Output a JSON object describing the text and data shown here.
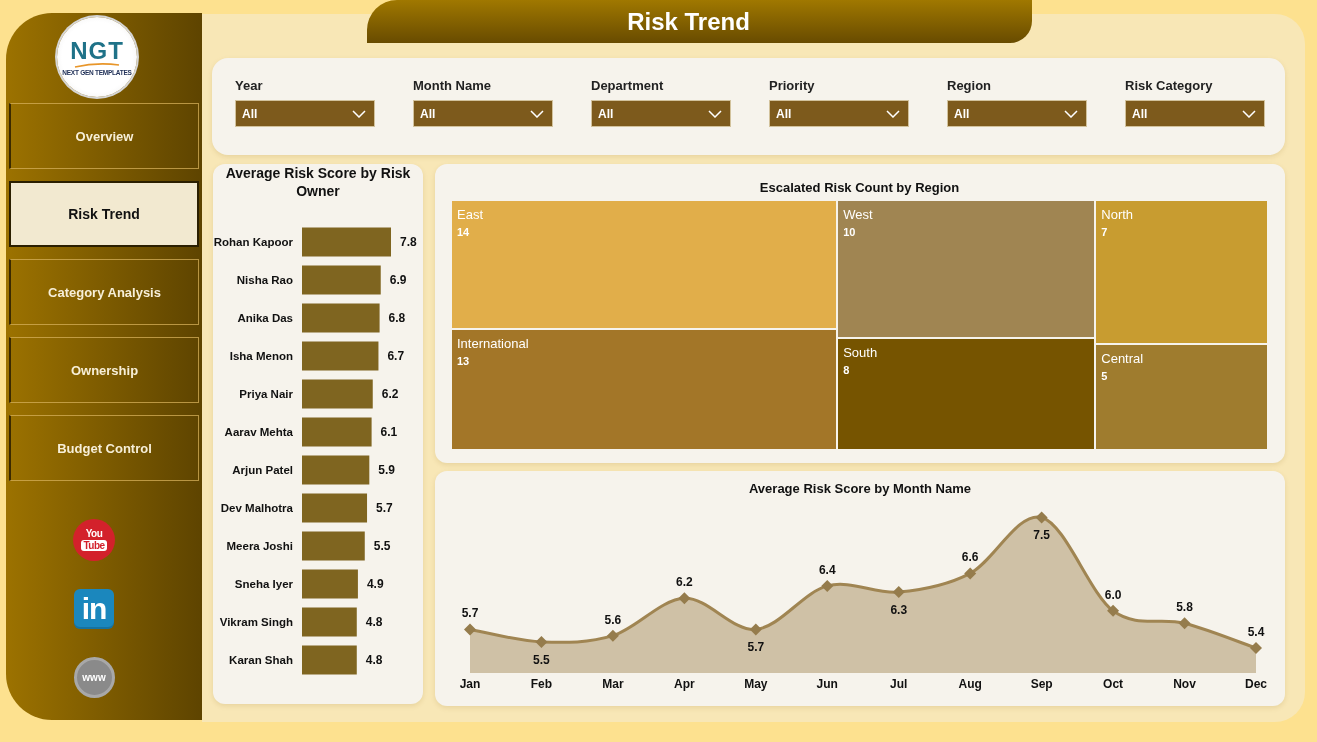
{
  "logo": {
    "initials": "NGT",
    "tagline": "NEXT GEN TEMPLATES"
  },
  "nav": [
    {
      "label": "Overview",
      "selected": false
    },
    {
      "label": "Risk Trend",
      "selected": true
    },
    {
      "label": "Category Analysis",
      "selected": false
    },
    {
      "label": "Ownership",
      "selected": false
    },
    {
      "label": "Budget Control",
      "selected": false
    }
  ],
  "social_links": [
    {
      "kind": "youtube",
      "lines": [
        "You",
        "Tube"
      ]
    },
    {
      "kind": "linkedin",
      "lines": [
        "in"
      ]
    },
    {
      "kind": "web",
      "lines": [
        "www"
      ]
    }
  ],
  "page_title": "Risk Trend",
  "filters": [
    {
      "label": "Year",
      "value": "All"
    },
    {
      "label": "Month Name",
      "value": "All"
    },
    {
      "label": "Department",
      "value": "All"
    },
    {
      "label": "Priority",
      "value": "All"
    },
    {
      "label": "Region",
      "value": "All"
    },
    {
      "label": "Risk Category",
      "value": "All"
    }
  ],
  "risk_owner_chart": {
    "chart_data": {
      "type": "bar",
      "orientation": "horizontal",
      "title": "Average Risk Score by Risk Owner",
      "categories": [
        "Rohan Kapoor",
        "Nisha Rao",
        "Anika Das",
        "Isha Menon",
        "Priya Nair",
        "Aarav Mehta",
        "Arjun Patel",
        "Dev Malhotra",
        "Meera Joshi",
        "Sneha Iyer",
        "Vikram Singh",
        "Karan Shah"
      ],
      "values": [
        7.8,
        6.9,
        6.8,
        6.7,
        6.2,
        6.1,
        5.9,
        5.7,
        5.5,
        4.9,
        4.8,
        4.8
      ],
      "data_labels": true
    }
  },
  "region_treemap": {
    "title": "Escalated Risk Count by Region",
    "tiles": [
      {
        "label": "East",
        "value": "14",
        "color": "#e1ae4a"
      },
      {
        "label": "International",
        "value": "13",
        "color": "#a37628"
      },
      {
        "label": "West",
        "value": "10",
        "color": "#a08552"
      },
      {
        "label": "South",
        "value": "8",
        "color": "#765400"
      },
      {
        "label": "North",
        "value": "7",
        "color": "#c89c30"
      },
      {
        "label": "Central",
        "value": "5",
        "color": "#9f7c2e"
      }
    ]
  },
  "month_chart": {
    "chart_data": {
      "type": "area",
      "title": "Average Risk Score by Month Name",
      "categories": [
        "Jan",
        "Feb",
        "Mar",
        "Apr",
        "May",
        "Jun",
        "Jul",
        "Aug",
        "Sep",
        "Oct",
        "Nov",
        "Dec"
      ],
      "series": [
        {
          "color": "#a08552",
          "values": [
            5.7,
            5.5,
            5.6,
            6.2,
            5.7,
            6.4,
            6.3,
            6.6,
            7.5,
            6.0,
            5.8,
            5.4
          ],
          "value_labels": [
            "5.7",
            "5.5",
            "5.6",
            "6.2",
            "5.7",
            "6.4",
            "6.3",
            "6.6",
            "7.5",
            "6.0",
            "5.8",
            "5.4"
          ]
        }
      ],
      "data_labels": true
    }
  }
}
